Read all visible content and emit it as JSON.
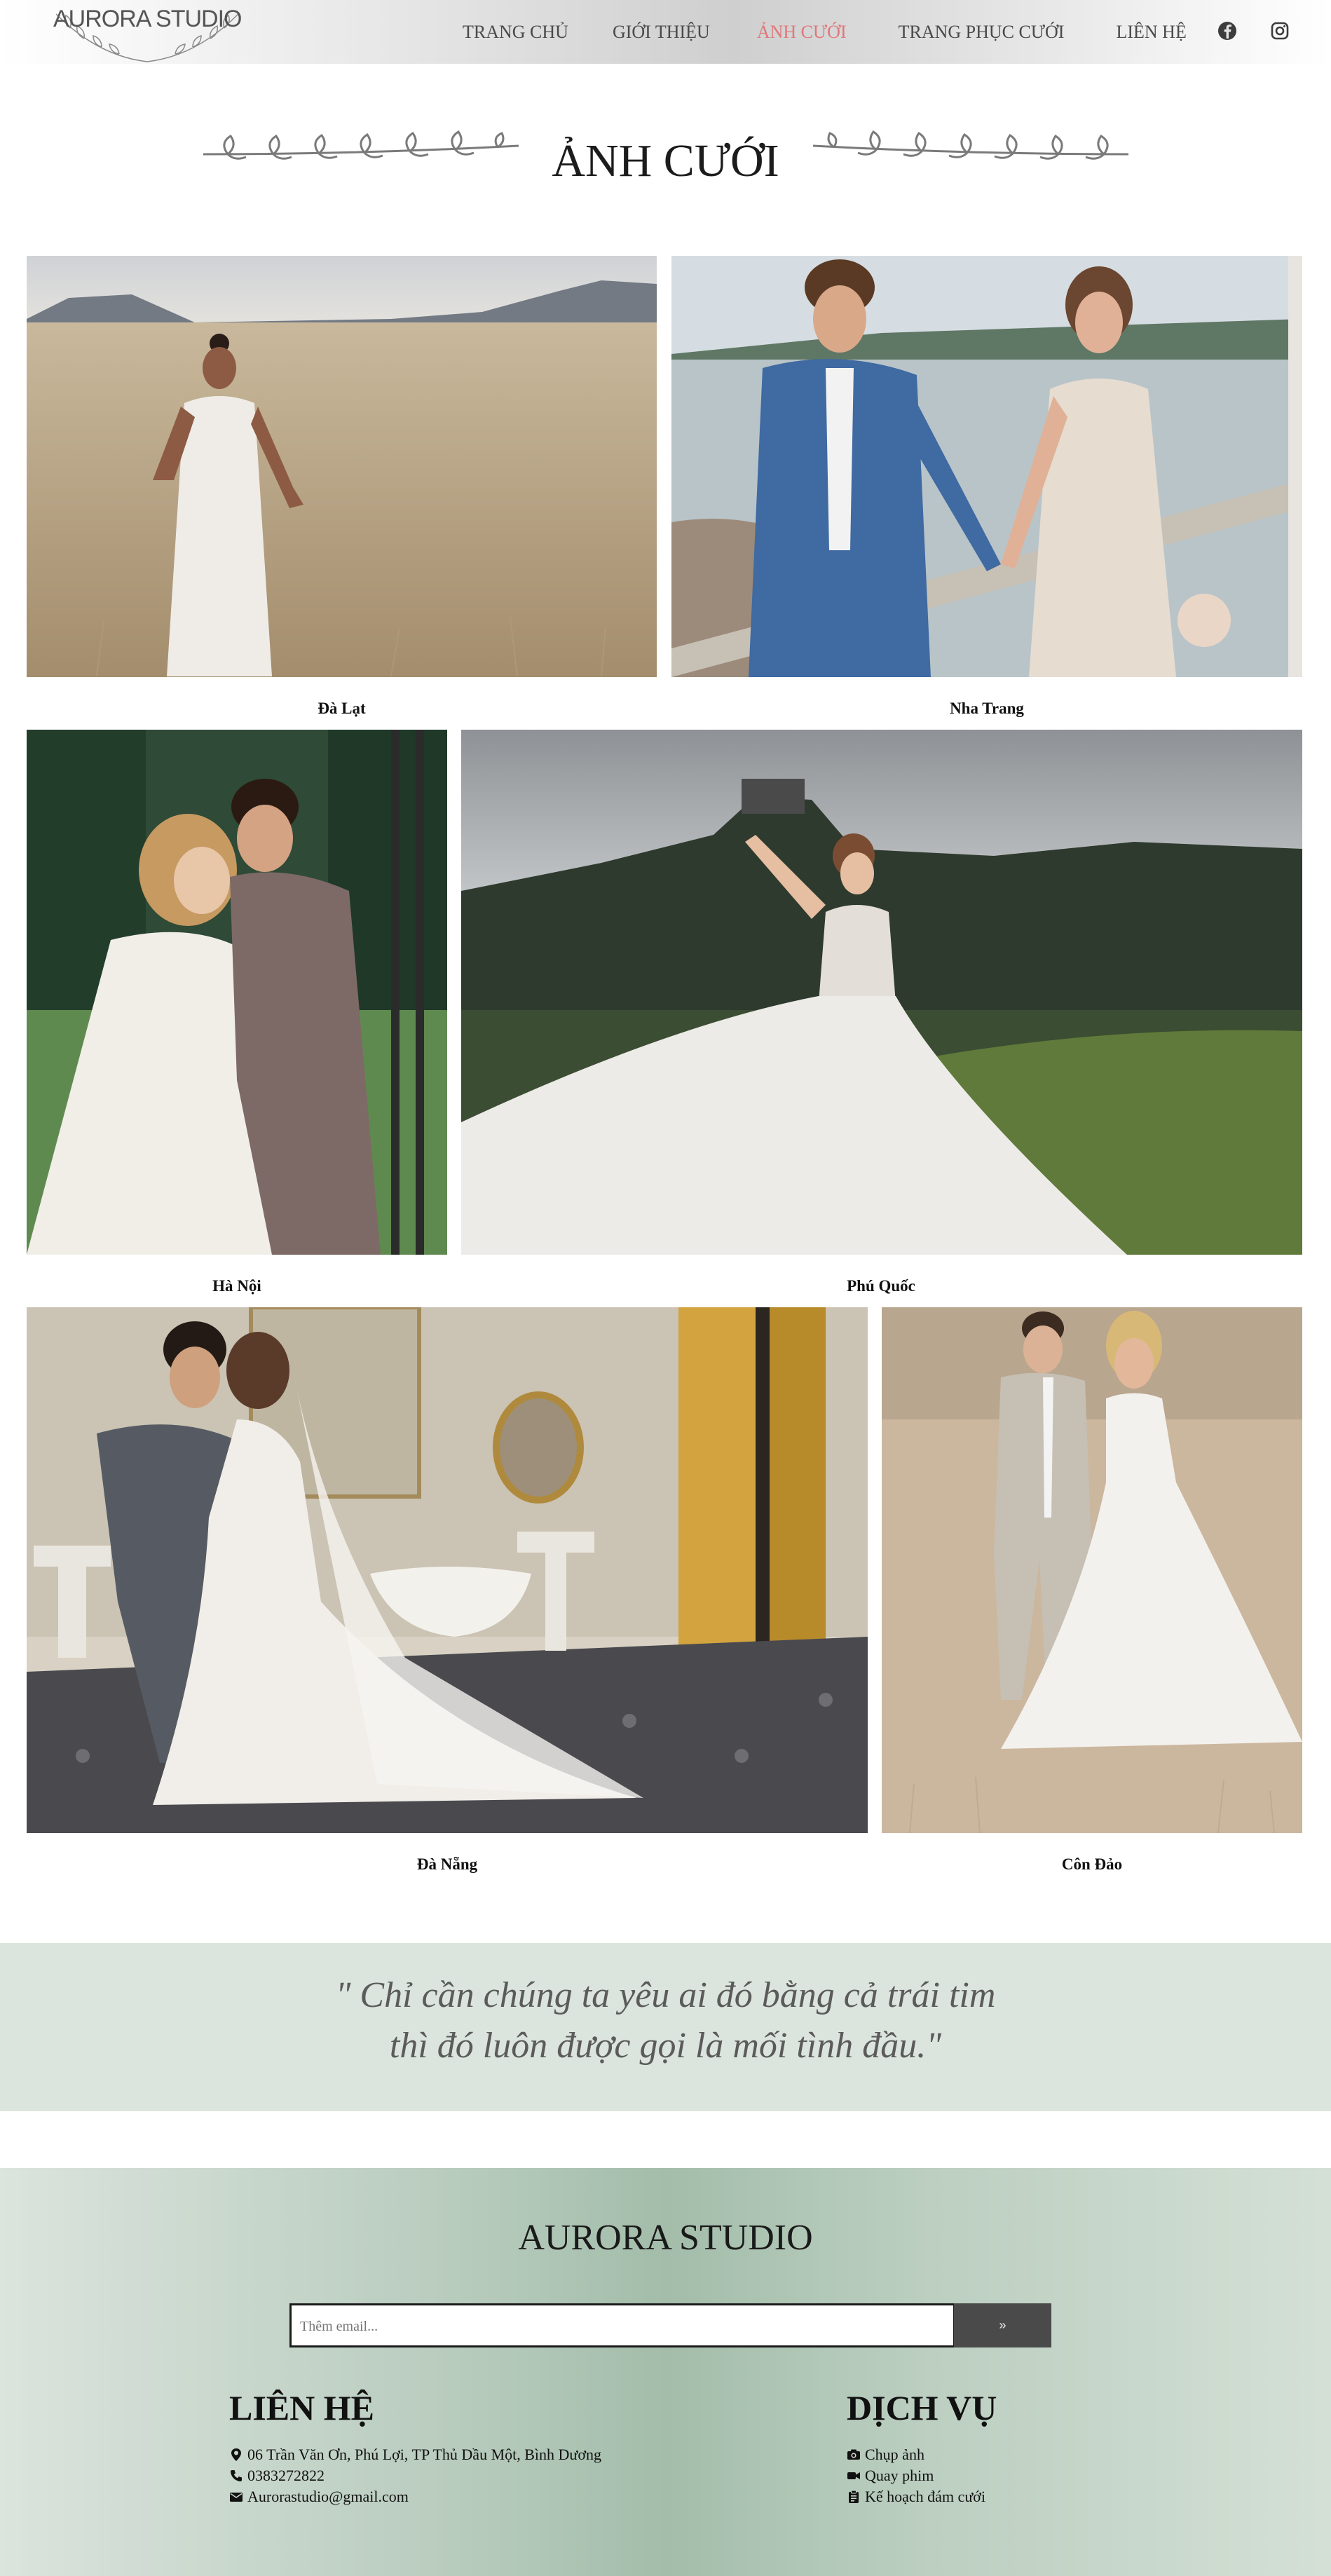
{
  "nav": {
    "logo_text": "AURORA STUDIO",
    "items": [
      {
        "label": "TRANG CHỦ",
        "active": false
      },
      {
        "label": "GIỚI THIỆU",
        "active": false
      },
      {
        "label": "ẢNH CƯỚI",
        "active": true
      },
      {
        "label": "TRANG PHỤC CƯỚI",
        "active": false
      },
      {
        "label": "LIÊN HỆ",
        "active": false
      }
    ],
    "social": [
      "facebook-icon",
      "instagram-icon"
    ],
    "active_color": "#e0777b"
  },
  "section": {
    "title": "ẢNH CƯỚI"
  },
  "gallery": [
    {
      "caption": "Đà Lạt"
    },
    {
      "caption": "Nha Trang"
    },
    {
      "caption": "Hà Nội"
    },
    {
      "caption": "Phú Quốc"
    },
    {
      "caption": "Đà Nẵng"
    },
    {
      "caption": "Côn Đảo"
    }
  ],
  "quote": {
    "line1": "\" Chỉ cần chúng ta yêu ai đó bằng cả trái tim",
    "line2": "thì đó luôn được gọi là mối tình đầu.\""
  },
  "footer": {
    "title": "AURORA STUDIO",
    "email_placeholder": "Thêm email...",
    "submit_label": "»",
    "contact": {
      "heading": "LIÊN HỆ",
      "address": "06 Trần Văn Ơn, Phú Lợi, TP Thủ Dầu Một, Bình Dương",
      "phone": "0383272822",
      "email": "Aurorastudio@gmail.com"
    },
    "services": {
      "heading": "DỊCH VỤ",
      "items": [
        "Chụp ảnh",
        "Quay phim",
        "Kế hoạch đám cưới"
      ]
    }
  }
}
